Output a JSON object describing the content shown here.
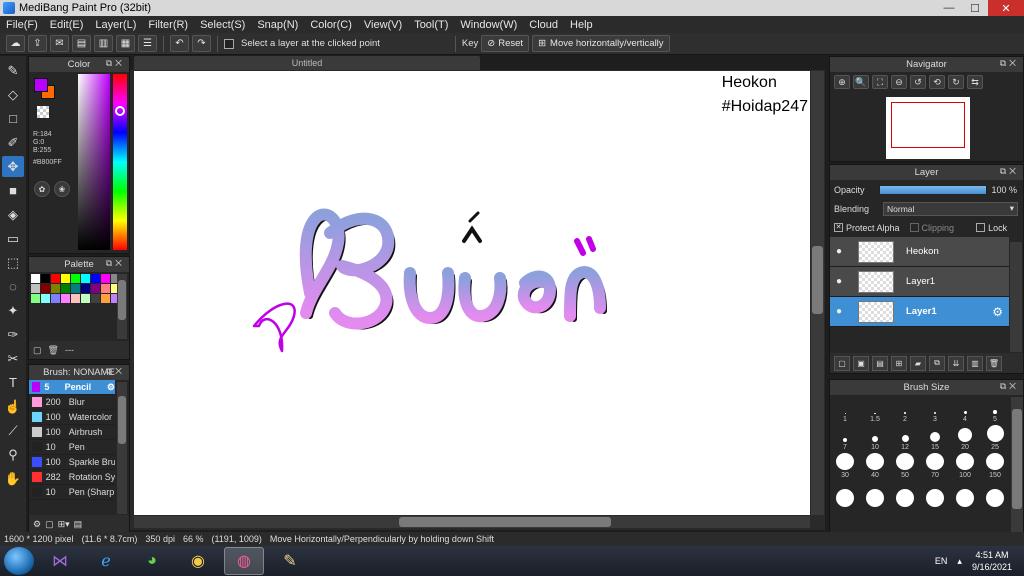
{
  "window": {
    "title": "MediBang Paint Pro (32bit)",
    "minimize": "—",
    "maximize": "☐",
    "close": "✕"
  },
  "menu": [
    "File(F)",
    "Edit(E)",
    "Layer(L)",
    "Filter(R)",
    "Select(S)",
    "Snap(N)",
    "Color(C)",
    "View(V)",
    "Tool(T)",
    "Window(W)",
    "Cloud",
    "Help"
  ],
  "toolbar": {
    "select_layer_label": "Select a layer at the clicked point",
    "key_label": "Key",
    "reset_label": "Reset",
    "move_label": "Move horizontally/vertically"
  },
  "color_panel": {
    "title": "Color",
    "r": "R:184",
    "g": "G:0",
    "b": "B:255",
    "hex": "#B800FF",
    "foreground": "#B800FF",
    "background": "#FF6A00"
  },
  "palette_panel": {
    "title": "Palette",
    "footer_text": "---",
    "colors": [
      "#ffffff",
      "#000000",
      "#ff0000",
      "#ffff00",
      "#00ff00",
      "#00ffff",
      "#0000ff",
      "#ff00ff",
      "#888888",
      "#c0c0c0",
      "#800000",
      "#808000",
      "#008000",
      "#008080",
      "#000080",
      "#800080",
      "#ff8080",
      "#ffff80",
      "#80ff80",
      "#80ffff",
      "#8080ff",
      "#ff80ff",
      "#ffc0c0",
      "#c0ffc0",
      "#404040",
      "#ffa040",
      "#c080ff"
    ]
  },
  "brush_panel": {
    "title": "Brush: NONAME",
    "items": [
      {
        "size": "5",
        "name": "Pencil",
        "color": "#b800ff"
      },
      {
        "size": "200",
        "name": "Blur",
        "color": "#ff9bdc"
      },
      {
        "size": "100",
        "name": "Watercolor",
        "color": "#6fd4ff"
      },
      {
        "size": "100",
        "name": "Airbrush",
        "color": "#cccccc"
      },
      {
        "size": "10",
        "name": "Pen",
        "color": "#222222"
      },
      {
        "size": "100",
        "name": "Sparkle Bru",
        "color": "#3b4dff"
      },
      {
        "size": "282",
        "name": "Rotation Sy",
        "color": "#ff3030"
      },
      {
        "size": "10",
        "name": "Pen (Sharp",
        "color": "#222222"
      }
    ]
  },
  "document": {
    "tab_title": "Untitled",
    "canvas_lines": [
      "Heokon",
      "#Hoidap247"
    ],
    "artwork_text": "Buồn",
    "gradient_top": "#8da0dc",
    "gradient_bottom": "#e48bef"
  },
  "navigator": {
    "title": "Navigator",
    "icons": [
      "zoom-fit",
      "zoom-in",
      "fit-window",
      "zoom-out",
      "rotate-left",
      "rotate-reset",
      "rotate-right",
      "flip"
    ]
  },
  "layer_panel": {
    "title": "Layer",
    "opacity_label": "Opacity",
    "opacity_value": "100 %",
    "blending_label": "Blending",
    "blending_value": "Normal",
    "protect_alpha": "Protect Alpha",
    "clipping": "Clipping",
    "lock": "Lock",
    "layers": [
      {
        "name": "Heokon",
        "selected": false
      },
      {
        "name": "Layer1",
        "selected": false
      },
      {
        "name": "Layer1",
        "selected": true
      }
    ]
  },
  "brush_size_panel": {
    "title": "Brush Size",
    "sizes": [
      "1",
      "1.5",
      "2",
      "3",
      "4",
      "5",
      "7",
      "10",
      "12",
      "15",
      "20",
      "25",
      "30",
      "40",
      "50",
      "70",
      "100",
      "150",
      "",
      "",
      "",
      "",
      "",
      ""
    ]
  },
  "status": {
    "pixels": "1600 * 1200 pixel",
    "cm": "(11.6 * 8.7cm)",
    "dpi": "350 dpi",
    "zoom": "66 %",
    "coords": "(1191, 1009)",
    "hint": "Move Horizontally/Perpendicularly by holding down Shift"
  },
  "taskbar": {
    "lang": "EN",
    "time": "4:51 AM",
    "date": "9/16/2021"
  }
}
